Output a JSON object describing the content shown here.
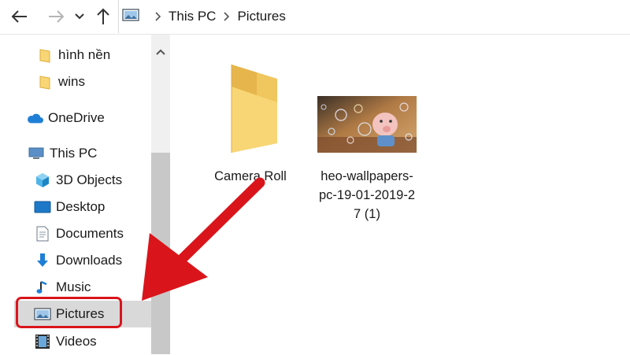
{
  "nav": {
    "back_icon": "arrow-left-icon",
    "forward_icon": "arrow-right-icon",
    "recent_icon": "chevron-down-icon",
    "up_icon": "arrow-up-icon"
  },
  "address": {
    "crumbs": [
      "This PC",
      "Pictures"
    ]
  },
  "sidebar": {
    "items": [
      {
        "label": "hình nền",
        "icon": "folder-icon"
      },
      {
        "label": "wins",
        "icon": "folder-icon"
      },
      {
        "label": "OneDrive",
        "icon": "cloud-icon"
      },
      {
        "label": "This PC",
        "icon": "computer-icon"
      },
      {
        "label": "3D Objects",
        "icon": "cube-icon"
      },
      {
        "label": "Desktop",
        "icon": "desktop-icon"
      },
      {
        "label": "Documents",
        "icon": "document-icon"
      },
      {
        "label": "Downloads",
        "icon": "download-icon"
      },
      {
        "label": "Music",
        "icon": "music-icon"
      },
      {
        "label": "Pictures",
        "icon": "pictures-icon",
        "selected": true
      },
      {
        "label": "Videos",
        "icon": "film-icon"
      }
    ]
  },
  "content": {
    "items": [
      {
        "type": "folder",
        "name": "Camera Roll"
      },
      {
        "type": "image",
        "name_lines": [
          "heo-wallpapers-",
          "pc-19-01-2019-2",
          "7 (1)"
        ]
      }
    ]
  },
  "colors": {
    "annotation_red": "#d9151b",
    "folder_yellow": "#f8d675",
    "selection_gray": "#d9d9d9",
    "onedrive_blue": "#1f7fd6"
  }
}
